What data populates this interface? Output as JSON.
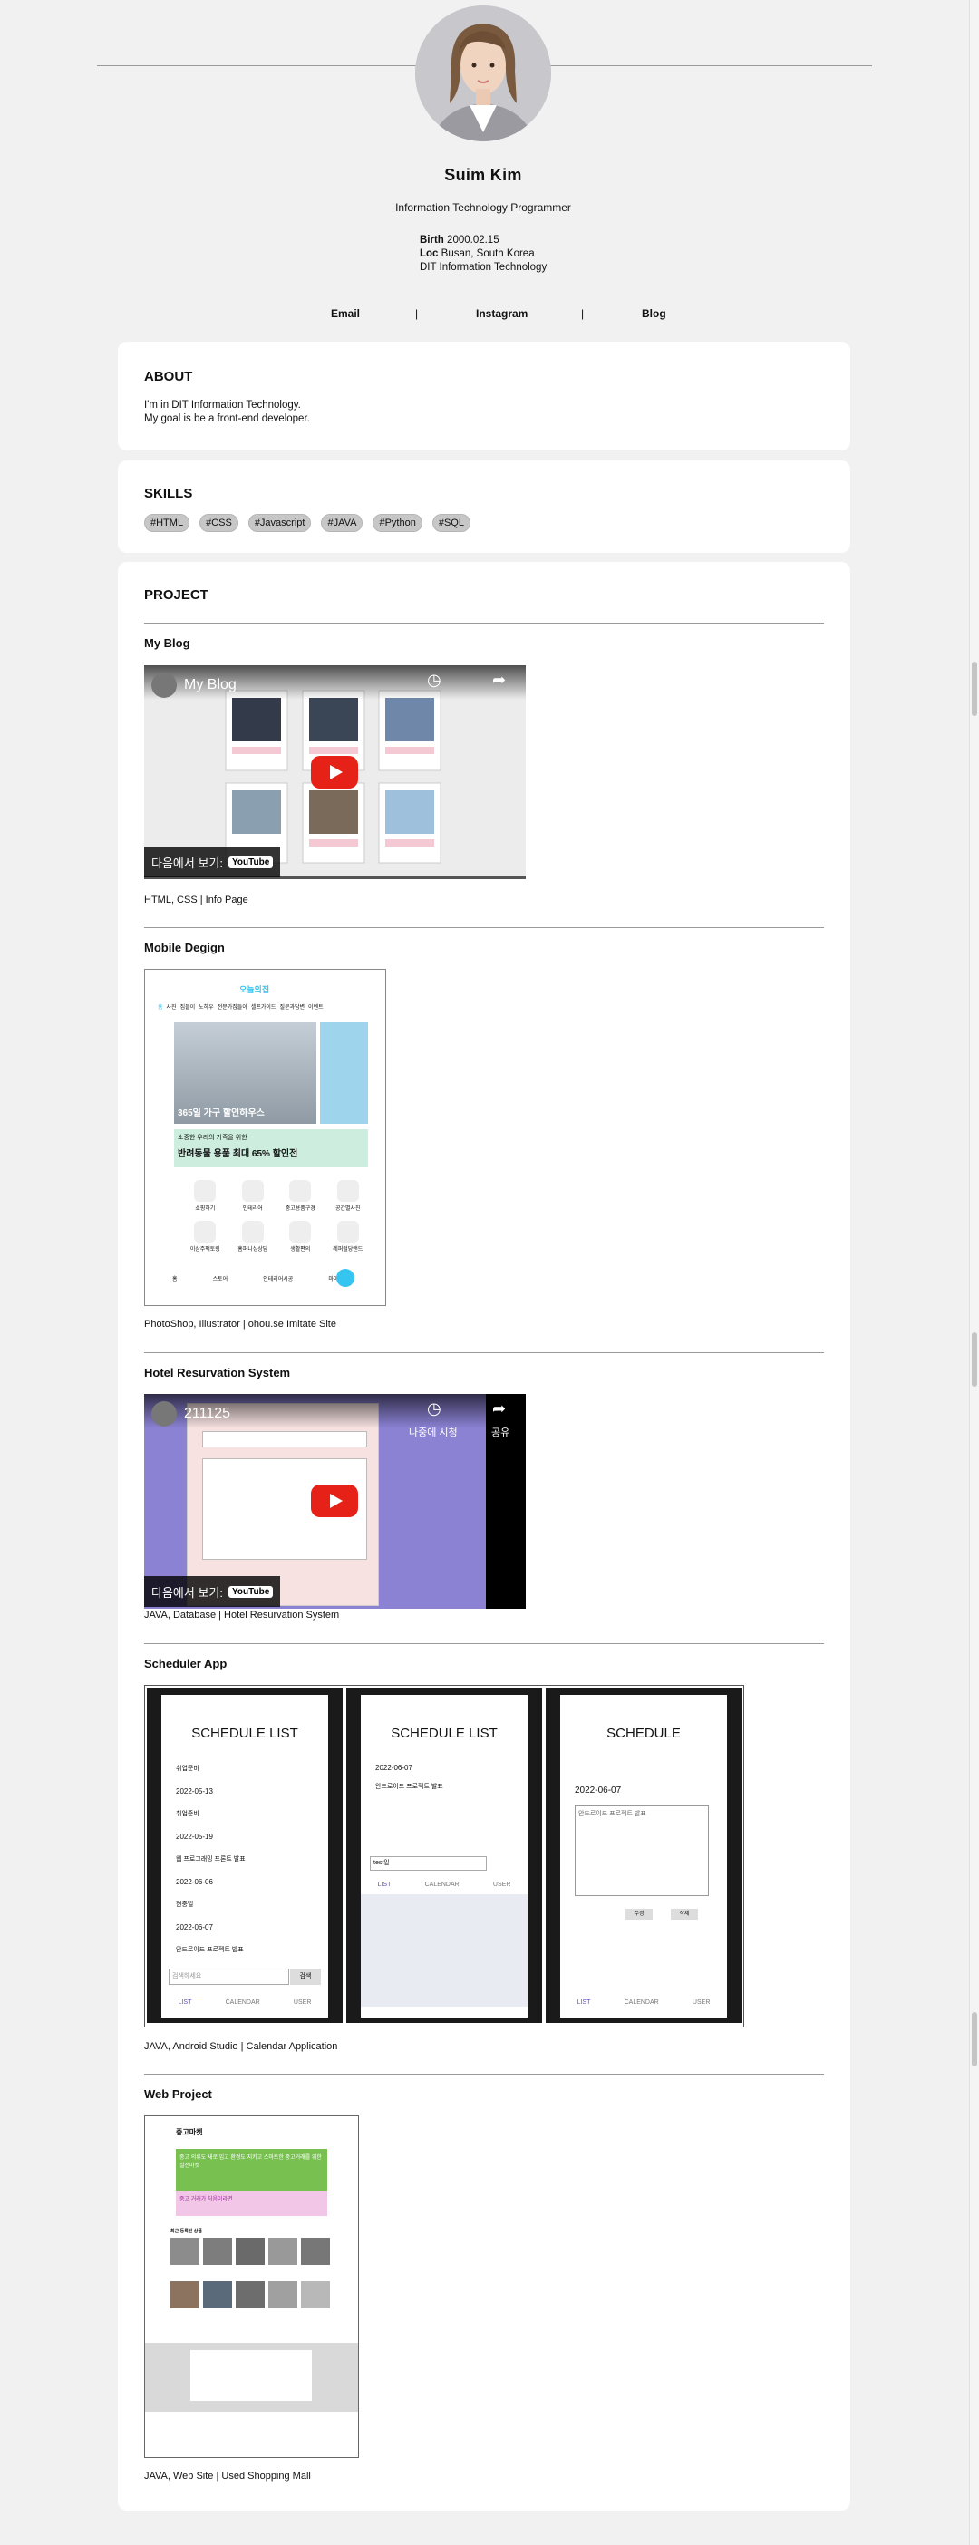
{
  "profile": {
    "name": "Suim Kim",
    "role": "Information Technology Programmer",
    "birth_label": "Birth",
    "birth": "2000.02.15",
    "loc_label": "Loc",
    "loc": "Busan, South Korea",
    "school": "DIT Information Technology"
  },
  "links": {
    "email": "Email",
    "sep": "|",
    "instagram": "Instagram",
    "blog": "Blog"
  },
  "about": {
    "title": "ABOUT",
    "line1": "I'm in DIT Information Technology.",
    "line2": "My goal is be a front-end developer."
  },
  "skills": {
    "title": "SKILLS",
    "tags": [
      "#HTML",
      "#CSS",
      "#Javascript",
      "#JAVA",
      "#Python",
      "#SQL"
    ]
  },
  "project": {
    "title": "PROJECT",
    "items": [
      {
        "title": "My Blog",
        "caption": "HTML, CSS | Info Page"
      },
      {
        "title": "Mobile Degign",
        "caption": "PhotoShop, Illustrator | ohou.se Imitate Site"
      },
      {
        "title": "Hotel Resurvation System",
        "caption": "JAVA, Database | Hotel Resurvation System"
      },
      {
        "title": "Scheduler App",
        "caption": "JAVA, Android Studio | Calendar Application"
      },
      {
        "title": "Web Project",
        "caption": "JAVA, Web Site | Used Shopping Mall"
      }
    ]
  },
  "youtube": {
    "watch_on": "다음에서 보기:",
    "logo": "YouTube",
    "video1_title": "My Blog",
    "video2_title": "211125",
    "video2_later": "나중에 시청",
    "video2_share": "공유"
  },
  "mobile": {
    "brand": "오늘의집",
    "tabs": [
      "홈",
      "사진",
      "집들이",
      "노하우",
      "전문가집들이",
      "셀프가이드",
      "질문과답변",
      "이벤트"
    ],
    "banner": "365일 가구 할인하우스",
    "promo_small": "소중한 우리의 가족을 위한",
    "promo": "반려동물 용품 최대 65% 할인전",
    "grid": [
      "쇼핑하기",
      "인테리어",
      "중고용품구경",
      "공간별사진",
      "이삼주팩토링",
      "홈퍼니싱상담",
      "생활편의",
      "레퍼럴당앤드"
    ],
    "nav": [
      "홈",
      "스토어",
      "인테리어시공",
      "마이페이지"
    ]
  },
  "scheduler": {
    "s1_title": "SCHEDULE LIST",
    "s1_items": [
      {
        "date": "",
        "text": "취업준비"
      },
      {
        "date": "2022-05-13",
        "text": "취업준비"
      },
      {
        "date": "2022-05-19",
        "text": "웹 프로그래밍 프론트 발표"
      },
      {
        "date": "2022-06-06",
        "text": "현충일"
      },
      {
        "date": "2022-06-07",
        "text": "안드로이드 프로젝트 발표"
      }
    ],
    "s1_search": "검색하세요",
    "s1_search_btn": "검색",
    "s2_title": "SCHEDULE LIST",
    "s2_date": "2022-06-07",
    "s2_item": "안드로이드 프로젝트 발표",
    "s2_input": "test일",
    "s3_title": "SCHEDULE",
    "s3_date": "2022-06-07",
    "s3_memo": "안드로이드 프로젝트 발표",
    "s3_btn1": "수정",
    "s3_btn2": "삭제",
    "tabs": [
      "LIST",
      "CALENDAR",
      "USER"
    ]
  },
  "web": {
    "brand": "중고마켓",
    "banner1": "중고 의류도 새로 입고 환경도 지키고 스마트한 중고거래를 위한 실전마켓",
    "banner2": "중고 거래가 처음이라면",
    "section": "최근 등록된 상품"
  }
}
